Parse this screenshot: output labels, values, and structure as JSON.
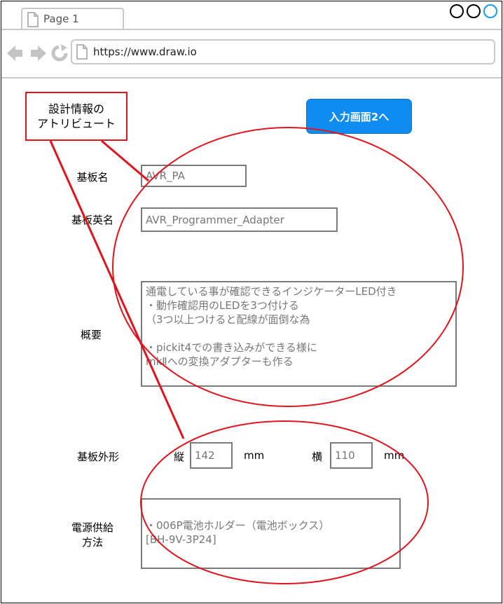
{
  "browser": {
    "tab_title": "Page 1",
    "url": "https://www.draw.io",
    "window_button_accent": "#1b9af0"
  },
  "annotation": {
    "label": "設計情報の\nアトリビュート",
    "color": "#e0141e"
  },
  "next_button": {
    "label": "入力画面2へ",
    "color": "#0f8cf0"
  },
  "form": {
    "board_name": {
      "label": "基板名",
      "value": "AVR_PA"
    },
    "board_name_en": {
      "label": "基板英名",
      "value": "AVR_Programmer_Adapter"
    },
    "summary": {
      "label": "概要",
      "value": "通電している事が確認できるインジケーターLED付き\n・動作確認用のLEDを3つ付ける\n（3つ以上つけると配線が面倒な為\n\n・pickit4での書き込みができる様に\nmkⅡへの変換アダプターも作る"
    },
    "board_shape": {
      "label": "基板外形",
      "height_label": "縦",
      "height_value": "142",
      "height_unit": "mm",
      "width_label": "横",
      "width_value": "110",
      "width_unit": "mm"
    },
    "power_supply": {
      "label": "電源供給\n方法",
      "value": "・006P電池ホルダー（電池ボックス）\n[BH-9V-3P24]"
    }
  }
}
